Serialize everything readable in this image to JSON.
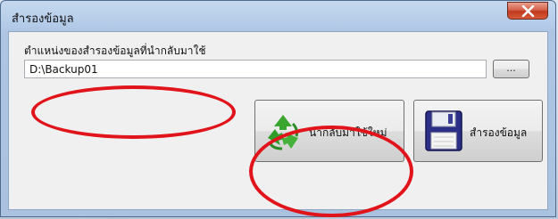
{
  "window": {
    "title": "สำรองข้อมูล"
  },
  "form": {
    "folder_label": "ตำแหน่งของสำรองข้อมูลที่นำกลับมาใช้",
    "path_value": "D:\\Backup01",
    "browse_label": "..."
  },
  "buttons": {
    "restore_label": "นำกลับมาใช้ใหม่",
    "backup_label": "สำรองข้อมูล"
  },
  "icons": {
    "close": "close-icon",
    "restore": "recycle-icon",
    "backup": "floppy-disk-icon"
  },
  "colors": {
    "annotation": "#e0141a",
    "close_button": "#c1391c",
    "recycle": "#3aa52f"
  }
}
